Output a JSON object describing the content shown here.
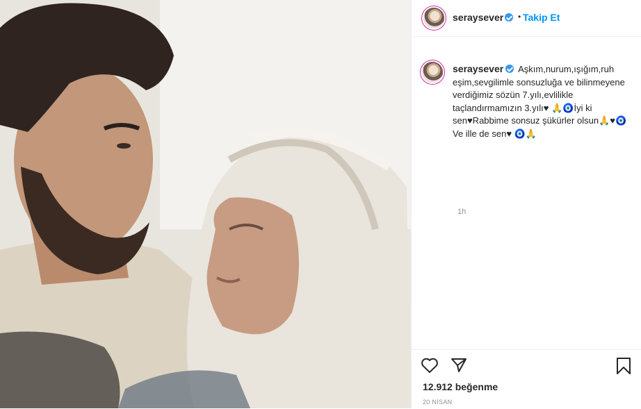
{
  "post": {
    "author": "seraysever",
    "follow_label": "Takip Et",
    "separator": "•",
    "caption_text": "Aşkım,nurum,ışığım,ruh eşim,sevgilimle sonsuzluğa ve bilinmeyene verdiğimiz sözün 7.yılı,evlilikle taçlandırmamızın 3.yılı♥ 🙏🧿İyi ki sen♥Rabbime sonsuz şükürler olsun🙏♥🧿 Ve ille de sen♥ 🧿🙏",
    "time_ago": "1h",
    "likes": "12.912 beğenme",
    "date": "20 NİSAN"
  },
  "icons": {
    "verified": "verified-badge-icon",
    "like": "heart-icon",
    "share": "paper-plane-icon",
    "save": "bookmark-icon"
  },
  "colors": {
    "accent": "#0095f6",
    "verified": "#3897f0",
    "muted": "#8e8e8e",
    "text": "#262626"
  }
}
